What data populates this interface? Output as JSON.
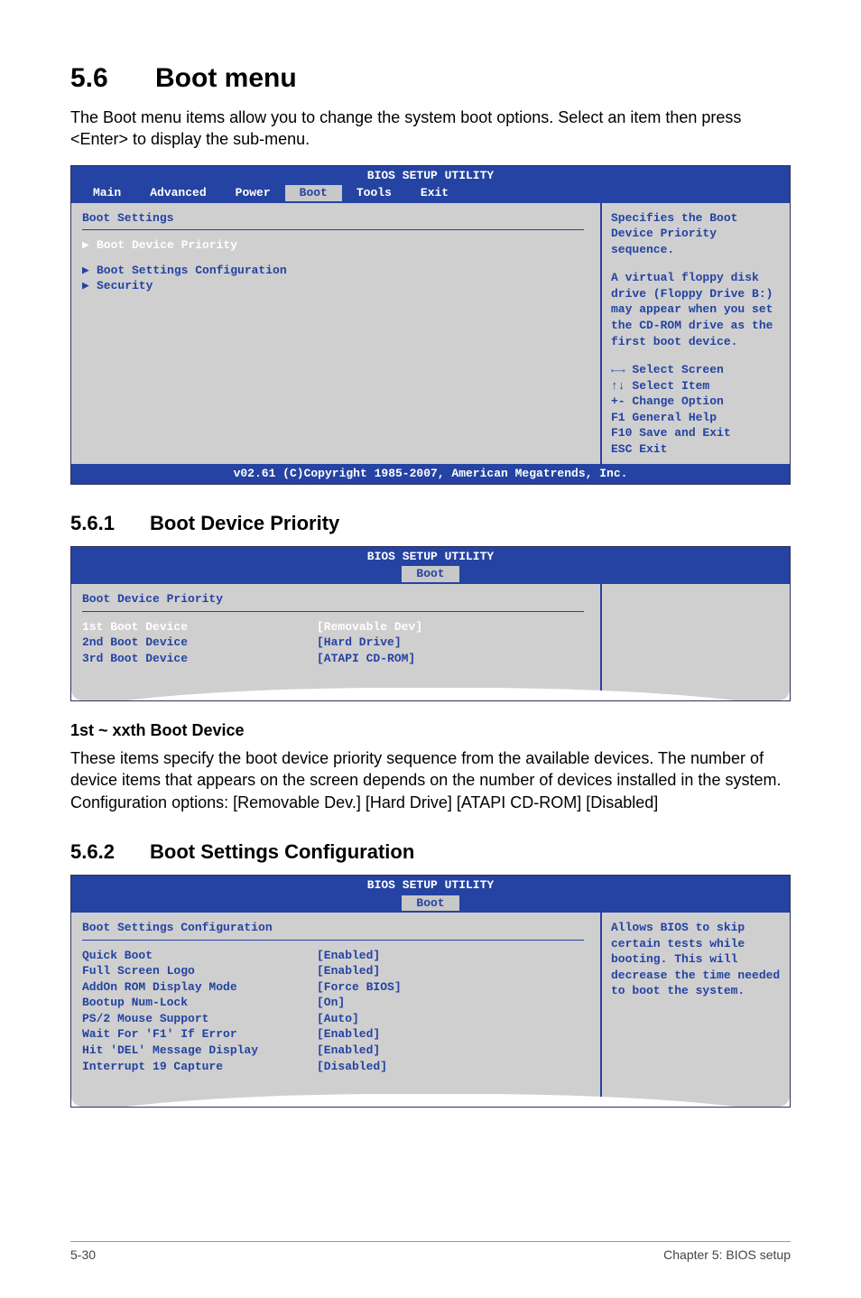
{
  "heading": {
    "num": "5.6",
    "text": "Boot menu"
  },
  "intro": "The Boot menu items allow you to change the system boot options. Select an item then press <Enter> to display the sub-menu.",
  "bios1": {
    "title": "BIOS SETUP UTILITY",
    "tabs": [
      "Main",
      "Advanced",
      "Power",
      "Boot",
      "Tools",
      "Exit"
    ],
    "active_tab": "Boot",
    "group_title": "Boot Settings",
    "items": [
      {
        "label": "Boot Device Priority",
        "highlight": true
      },
      {
        "label": "Boot Settings Configuration",
        "highlight": false
      },
      {
        "label": "Security",
        "highlight": false
      }
    ],
    "help1": "Specifies the Boot Device Priority sequence.",
    "help2": "A virtual floppy disk drive (Floppy Drive B:) may appear when you set the CD-ROM drive as the first boot device.",
    "nav": [
      "←→ Select Screen",
      "↑↓  Select Item",
      "+-  Change Option",
      "F1  General Help",
      "F10 Save and Exit",
      "ESC Exit"
    ],
    "copyright": "v02.61 (C)Copyright 1985-2007, American Megatrends, Inc."
  },
  "sub1": {
    "num": "5.6.1",
    "title": "Boot Device Priority"
  },
  "bios2": {
    "title": "BIOS SETUP UTILITY",
    "active_tab": "Boot",
    "group_title": "Boot Device Priority",
    "rows": [
      {
        "label": "1st Boot Device",
        "value": "[Removable Dev]",
        "highlight": true
      },
      {
        "label": "2nd Boot Device",
        "value": "[Hard Drive]",
        "highlight": false
      },
      {
        "label": "3rd Boot Device",
        "value": "[ATAPI CD-ROM]",
        "highlight": false
      }
    ]
  },
  "xxth_title": "1st ~ xxth Boot Device",
  "xxth_text": "These items specify the boot device priority sequence from the available devices. The number of device items that appears on the screen depends on the number of devices installed in the system. Configuration options: [Removable Dev.] [Hard Drive] [ATAPI CD-ROM] [Disabled]",
  "sub2": {
    "num": "5.6.2",
    "title": "Boot Settings Configuration"
  },
  "bios3": {
    "title": "BIOS SETUP UTILITY",
    "active_tab": "Boot",
    "group_title": "Boot Settings Configuration",
    "rows": [
      {
        "label": "Quick Boot",
        "value": "[Enabled]"
      },
      {
        "label": "Full Screen Logo",
        "value": "[Enabled]"
      },
      {
        "label": "AddOn ROM Display Mode",
        "value": "[Force BIOS]"
      },
      {
        "label": "Bootup Num-Lock",
        "value": "[On]"
      },
      {
        "label": "PS/2 Mouse Support",
        "value": "[Auto]"
      },
      {
        "label": "Wait For 'F1' If Error",
        "value": "[Enabled]"
      },
      {
        "label": "Hit 'DEL' Message Display",
        "value": "[Enabled]"
      },
      {
        "label": "Interrupt 19 Capture",
        "value": "[Disabled]"
      }
    ],
    "help": "Allows BIOS to skip certain tests while booting. This will decrease the time needed to boot the system."
  },
  "footer": {
    "page": "5-30",
    "chapter": "Chapter 5: BIOS setup"
  }
}
